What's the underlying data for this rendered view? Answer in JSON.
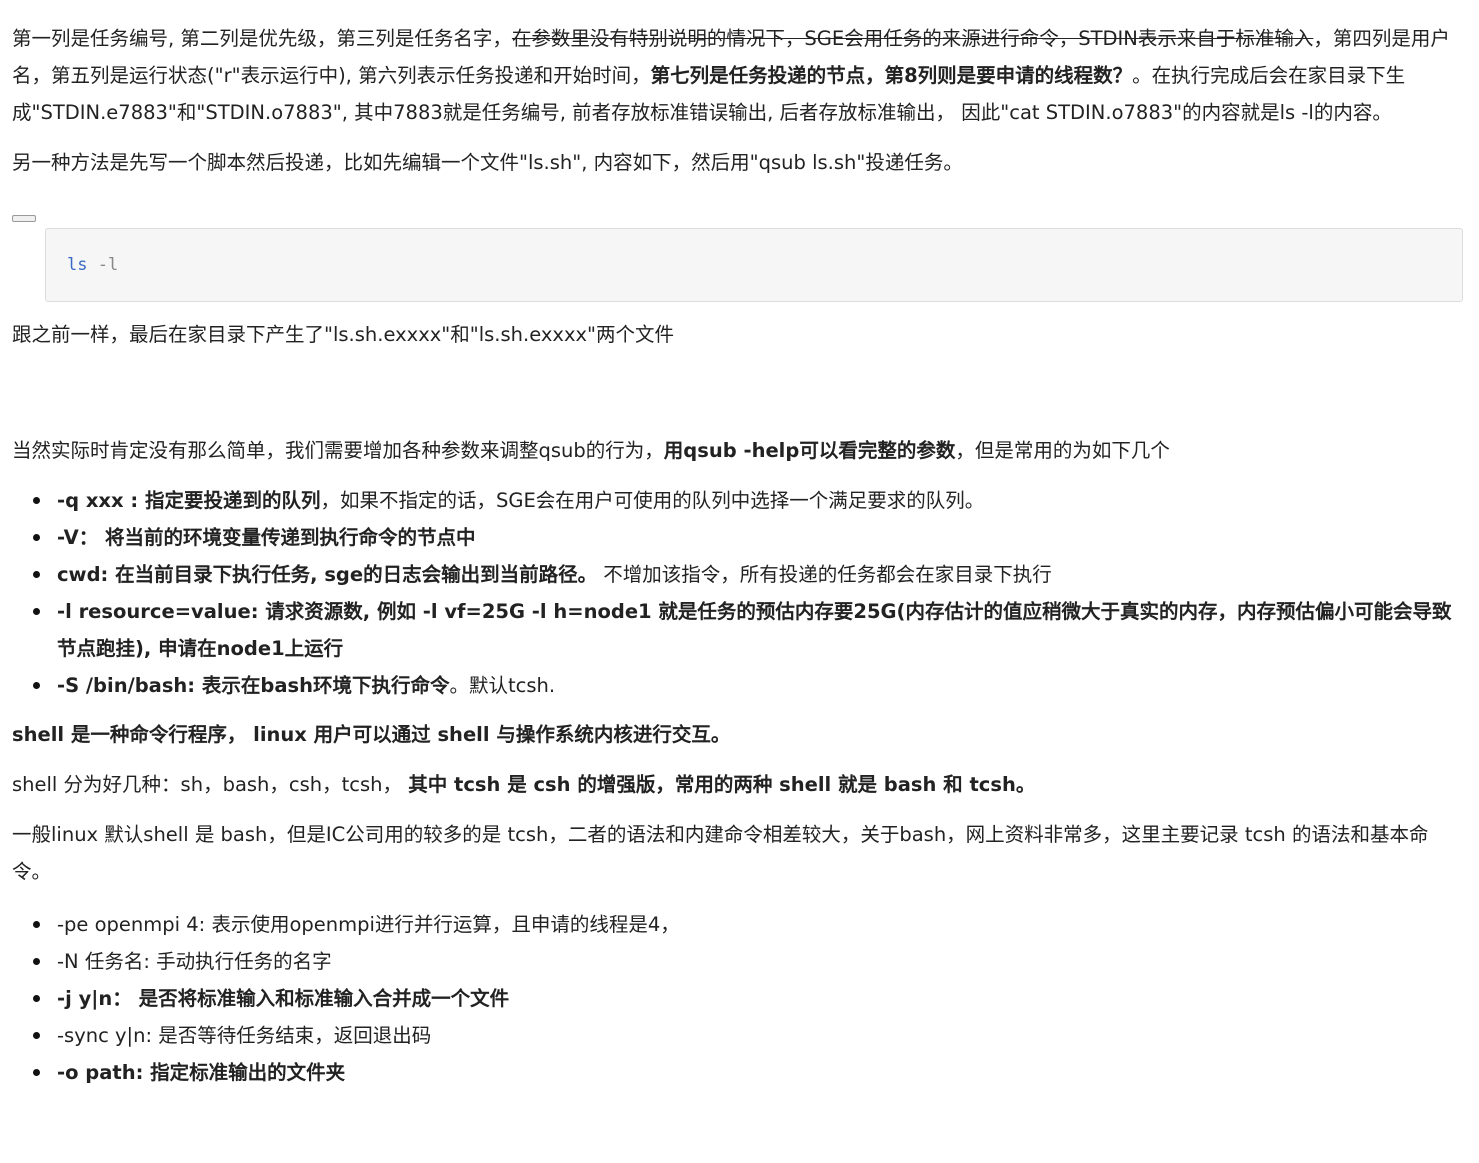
{
  "para1": {
    "t1": "第一列是任务编号, 第二列是优先级，第三列是任务名字，",
    "t2_strike": "在参数里没有特别说明的情况下，SGE会用任务的来源进行命令，STDIN表示来自于标准输入",
    "t3": "，第四列是用户名，第五列是运行状态(\"r\"表示运行中), 第六列表示任务投递和开始时间，",
    "t4_bold": "第七列是任务投递的节点，第8列则是要申请的线程数？",
    "t5": "。在执行完成后会在家目录下生成\"STDIN.e7883\"和\"STDIN.o7883\", 其中7883就是任务编号, 前者存放标准错误输出, 后者存放标准输出， 因此\"cat STDIN.o7883\"的内容就是ls -l的内容。"
  },
  "para2": "另一种方法是先写一个脚本然后投递，比如先编辑一个文件\"ls.sh\", 内容如下，然后用\"qsub ls.sh\"投递任务。",
  "code": {
    "cmd": "ls",
    "arg": "-l"
  },
  "para3": "跟之前一样，最后在家目录下产生了\"ls.sh.exxxx\"和\"ls.sh.exxxx\"两个文件",
  "para4": {
    "t1": "当然实际时肯定没有那么简单，我们需要增加各种参数来调整qsub的行为，",
    "t2_bold": "用qsub -help可以看完整的参数",
    "t3": "，但是常用的为如下几个"
  },
  "list1": [
    {
      "bold": "-q xxx : 指定要投递到的队列",
      "rest": "，如果不指定的话，SGE会在用户可使用的队列中选择一个满足要求的队列。"
    },
    {
      "bold": "-V： 将当前的环境变量传递到执行命令的节点中",
      "rest": ""
    },
    {
      "bold": "cwd: 在当前目录下执行任务, sge的日志会输出到当前路径。",
      "rest": " 不增加该指令，所有投递的任务都会在家目录下执行"
    },
    {
      "bold": "-l resource=value: 请求资源数, 例如 -l vf=25G -l h=node1 就是任务的预估内存要25G(内存估计的值应稍微大于真实的内存，内存预估偏小可能会导致节点跑挂), 申请在node1上运行",
      "rest": ""
    },
    {
      "bold": "-S /bin/bash: 表示在bash环境下执行命令",
      "rest": "。默认tcsh."
    }
  ],
  "para5_bold": "shell 是一种命令行程序， linux 用户可以通过 shell 与操作系统内核进行交互。",
  "para6": {
    "t1": "shell 分为好几种：sh，bash，csh，tcsh， ",
    "t2_bold": "其中 tcsh 是 csh 的增强版，常用的两种 shell 就是 bash 和 tcsh。"
  },
  "para7": "一般linux 默认shell 是 bash，但是IC公司用的较多的是 tcsh，二者的语法和内建命令相差较大，关于bash，网上资料非常多，这里主要记录 tcsh 的语法和基本命令。",
  "list2": [
    {
      "bold": "",
      "rest": "-pe openmpi 4: 表示使用openmpi进行并行运算，且申请的线程是4，"
    },
    {
      "bold": "",
      "rest": "-N 任务名: 手动执行任务的名字"
    },
    {
      "bold": "-j y|n： 是否将标准输入和标准输入合并成一个文件",
      "rest": ""
    },
    {
      "bold": "",
      "rest": "-sync y|n: 是否等待任务结束，返回退出码"
    },
    {
      "bold": "-o path: 指定标准输出的文件夹",
      "rest": ""
    }
  ]
}
